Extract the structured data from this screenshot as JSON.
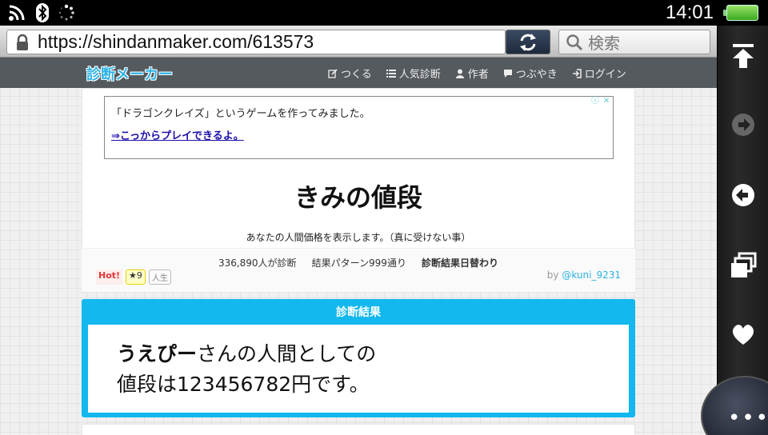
{
  "status": {
    "time": "14:01",
    "icons": [
      "wifi-icon",
      "bluetooth-icon",
      "loading-icon"
    ]
  },
  "browser": {
    "url": "https://shindanmaker.com/613573",
    "search_placeholder": "検索"
  },
  "site": {
    "logo": "診断メーカー",
    "nav": [
      {
        "label": "つくる",
        "icon": "edit-icon"
      },
      {
        "label": "人気診断",
        "icon": "list-icon"
      },
      {
        "label": "作者",
        "icon": "person-icon"
      },
      {
        "label": "つぶやき",
        "icon": "chat-icon"
      },
      {
        "label": "ログイン",
        "icon": "login-icon"
      }
    ]
  },
  "ad": {
    "line1": "「ドラゴンクレイズ」というゲームを作ってみました。",
    "line2": "⇒こっからプレイできるよ。"
  },
  "shindan": {
    "title": "きみの値段",
    "description": "あなたの人間価格を表示します。（真に受けない事）",
    "stats_count": "336,890人が診断",
    "stats_patterns": "結果パターン999通り",
    "stats_daily": "診断結果日替わり",
    "badge_hot": "Hot!",
    "badge_star": "★9",
    "badge_tag": "人生",
    "author_prefix": "by",
    "author": "@kuni_9231"
  },
  "result": {
    "header": "診断結果",
    "name": "うえぴー",
    "line1_rest": "さんの人間としての",
    "line2": "値段は123456782円です。"
  },
  "colors": {
    "accent": "#12b8ee",
    "nav_bg": "#555a5e",
    "link": "#1a0dab"
  }
}
